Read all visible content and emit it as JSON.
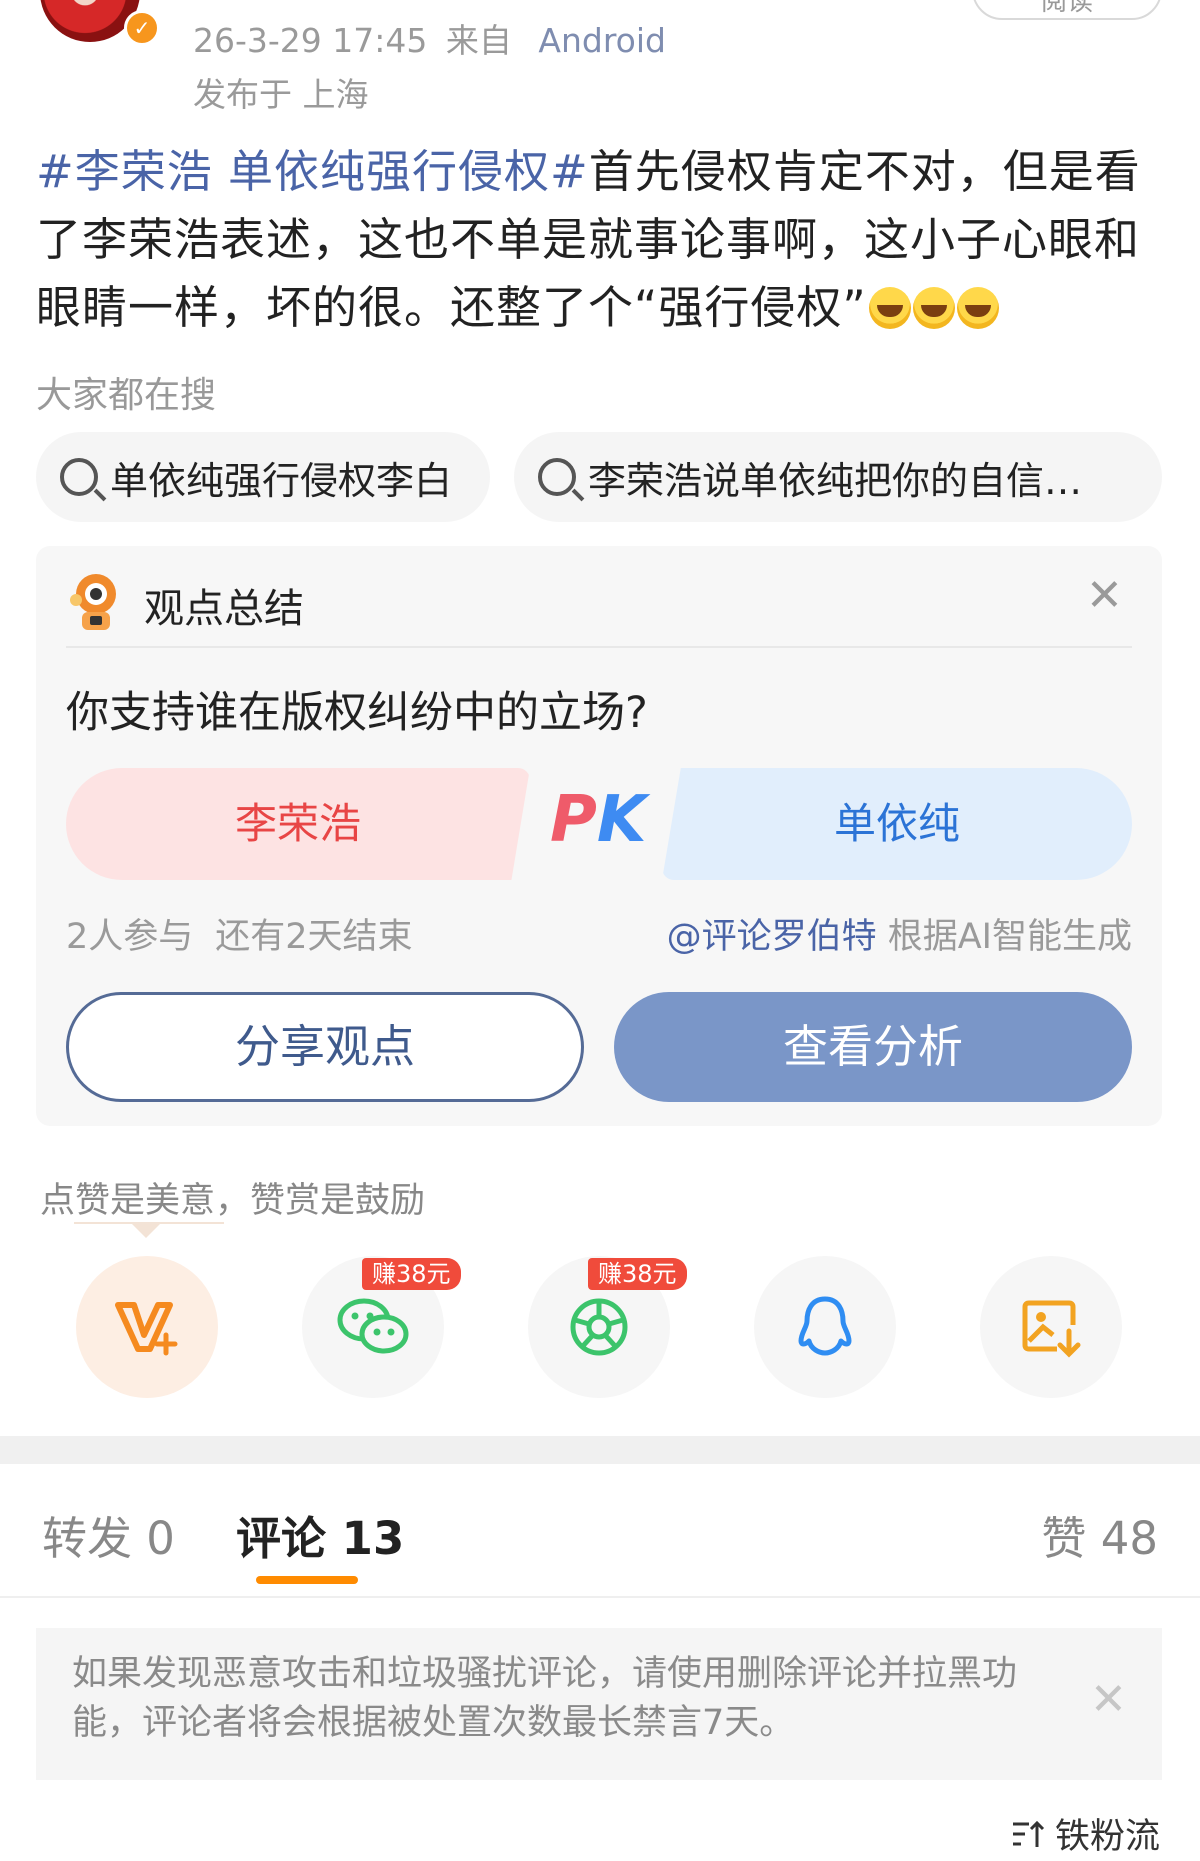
{
  "header": {
    "time": "26-3-29 17:45",
    "source_prefix": "来自",
    "source": "Android",
    "location": "发布于 上海",
    "read_button": "阅读"
  },
  "post": {
    "hashtag": "#李荣浩 单依纯强行侵权#",
    "text": "首先侵权肯定不对，但是看了李荣浩表述，这也不单是就事论事啊，这小子心眼和眼睛一样，坏的很。还整了个“强行侵权”"
  },
  "hot_search": {
    "title": "大家都在搜",
    "items": [
      "单依纯强行侵权李白",
      "李荣浩说单依纯把你的自信…"
    ]
  },
  "viewpoint": {
    "title": "观点总结",
    "question": "你支持谁在版权纠纷中的立场?",
    "left_option": "李荣浩",
    "pk_p": "P",
    "pk_k": "K",
    "right_option": "单依纯",
    "participants": "2人参与",
    "deadline": "还有2天结束",
    "ai_author": "@评论罗伯特",
    "ai_suffix": "根据AI智能生成",
    "share_button": "分享观点",
    "analysis_button": "查看分析"
  },
  "reward": {
    "text": "点赞是美意，赞赏是鼓励",
    "badge1": "赚38元",
    "badge2": "赚38元"
  },
  "tabs": {
    "repost": "转发 0",
    "comment": "评论 13",
    "like": "赞 48"
  },
  "notice": {
    "text": "如果发现恶意攻击和垃圾骚扰评论，请使用删除评论并拉黑功能，评论者将会根据被处置次数最长禁言7天。"
  },
  "sort": {
    "label": "铁粉流"
  },
  "colors": {
    "link": "#4a64a7",
    "accent": "#ff8b00",
    "pk_red": "#ef5b6a",
    "pk_blue": "#3e8bf2",
    "analysis_button": "#7a96c8"
  },
  "icons": [
    "vplus-icon",
    "wechat-icon",
    "moments-icon",
    "qq-icon",
    "save-image-icon",
    "search-icon",
    "close-icon",
    "robot-icon",
    "sort-icon"
  ]
}
